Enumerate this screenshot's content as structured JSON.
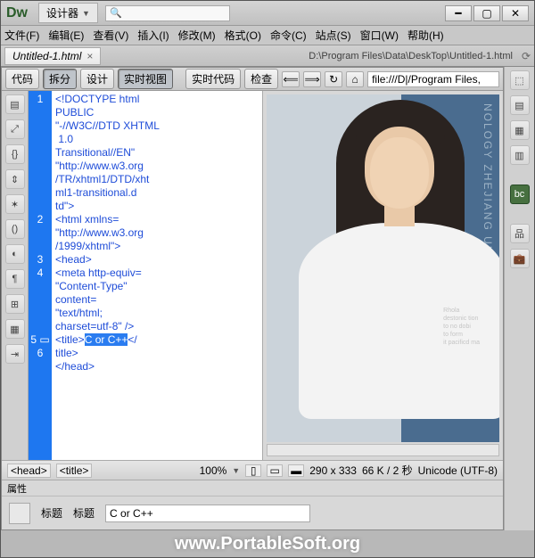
{
  "title": {
    "app_logo": "Dw",
    "layout_label": "设计器",
    "search_placeholder": ""
  },
  "menu": [
    "文件(F)",
    "编辑(E)",
    "查看(V)",
    "插入(I)",
    "修改(M)",
    "格式(O)",
    "命令(C)",
    "站点(S)",
    "窗口(W)",
    "帮助(H)"
  ],
  "tab": {
    "name": "Untitled-1.html",
    "path": "D:\\Program Files\\Data\\DeskTop\\Untitled-1.html"
  },
  "view_buttons": {
    "code": "代码",
    "split": "拆分",
    "design": "设计",
    "live_view": "实时视图",
    "live_code": "实时代码",
    "inspect": "检查",
    "address": "file:///D|/Program Files,"
  },
  "code_lines": {
    "l1": "<!DOCTYPE html PUBLIC \"-//W3C//DTD XHTML 1.0 Transitional//EN\" \"http://www.w3.org/TR/xhtml1/DTD/xhtml1-transitional.dtd\">",
    "l2": "<html xmlns=\"http://www.w3.org/1999/xhtml\">",
    "l3": "<head>",
    "l4": "<meta http-equiv=\"Content-Type\" content=\"text/html; charset=utf-8\" />",
    "l5_pre": "<title>",
    "l5_sel": "C or C++",
    "l5_post": "</title>",
    "l6": "</head>"
  },
  "preview_bg_text": "NOLOGY  ZHEJIANG UNIVERSITY",
  "statusbar": {
    "tags": [
      "<head>",
      "<title>"
    ],
    "zoom": "100%",
    "dims": "290 x 333",
    "size_time": "66 K / 2 秒",
    "encoding": "Unicode (UTF-8)"
  },
  "properties": {
    "panel_title": "属性",
    "section_label": "标题",
    "field_label": "标题",
    "field_value": "C or C++"
  },
  "watermark": "www.PortableSoft.org"
}
